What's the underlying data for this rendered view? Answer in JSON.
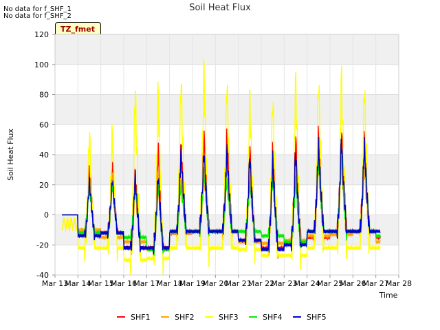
{
  "notes": [
    "No data for f_SHF_1",
    "No data for f_SHF_2"
  ],
  "badge": "TZ_fmet",
  "chart_data": {
    "type": "line",
    "title": "Soil Heat Flux",
    "xlabel": "Time",
    "ylabel": "Soil Heat Flux",
    "ylim": [
      -40,
      120
    ],
    "yticks": [
      -40,
      -20,
      0,
      20,
      40,
      60,
      80,
      100,
      120
    ],
    "xlim": [
      13,
      28
    ],
    "xticks": [
      13,
      14,
      15,
      16,
      17,
      18,
      19,
      20,
      21,
      22,
      23,
      24,
      25,
      26,
      27,
      28
    ],
    "xticklabels": [
      "Mar 13",
      "Mar 14",
      "Mar 15",
      "Mar 16",
      "Mar 17",
      "Mar 18",
      "Mar 19",
      "Mar 20",
      "Mar 21",
      "Mar 22",
      "Mar 23",
      "Mar 24",
      "Mar 25",
      "Mar 26",
      "Mar 27",
      "Mar 28"
    ],
    "grid": true,
    "legend_position": "bottom",
    "day_range": [
      13.3,
      27.2
    ],
    "series": [
      {
        "name": "SHF1",
        "color": "#ff0000",
        "peaks": [
          33,
          34,
          30,
          47,
          46,
          56,
          56,
          47,
          47,
          55,
          58,
          59,
          55,
          44
        ],
        "night": [
          -12,
          -12,
          -22,
          -22,
          -12,
          -11,
          -11,
          -17,
          -22,
          -18,
          -15,
          -11,
          -11,
          -15
        ]
      },
      {
        "name": "SHF2",
        "color": "#ffa500",
        "peaks": [
          28,
          27,
          20,
          25,
          30,
          30,
          30,
          30,
          30,
          35,
          35,
          37,
          32,
          25
        ],
        "night": [
          -10,
          -15,
          -18,
          -23,
          -12,
          -11,
          -11,
          -18,
          -19,
          -17,
          -14,
          -13,
          -11,
          -18
        ]
      },
      {
        "name": "SHF3",
        "color": "#ffff00",
        "peaks": [
          59,
          59,
          91,
          88,
          97,
          105,
          96,
          85,
          84,
          96,
          96,
          98,
          93,
          88
        ],
        "night": [
          -22,
          -22,
          -30,
          -29,
          -22,
          -22,
          -22,
          -23,
          -27,
          -27,
          -22,
          -22,
          -22,
          -22
        ]
      },
      {
        "name": "SHF4",
        "color": "#00ee00",
        "peaks": [
          22,
          22,
          25,
          22,
          22,
          30,
          25,
          22,
          25,
          25,
          38,
          46,
          48,
          38
        ],
        "night": [
          -12,
          -12,
          -15,
          -23,
          -11,
          -11,
          -11,
          -11,
          -14,
          -18,
          -11,
          -11,
          -11,
          -14
        ]
      },
      {
        "name": "SHF5",
        "color": "#0000cc",
        "peaks": [
          25,
          26,
          29,
          29,
          45,
          45,
          45,
          42,
          40,
          45,
          49,
          53,
          49,
          45
        ],
        "night": [
          -14,
          -12,
          -22,
          -22,
          -11,
          -11,
          -11,
          -17,
          -23,
          -20,
          -11,
          -11,
          -11,
          -11
        ]
      }
    ]
  }
}
